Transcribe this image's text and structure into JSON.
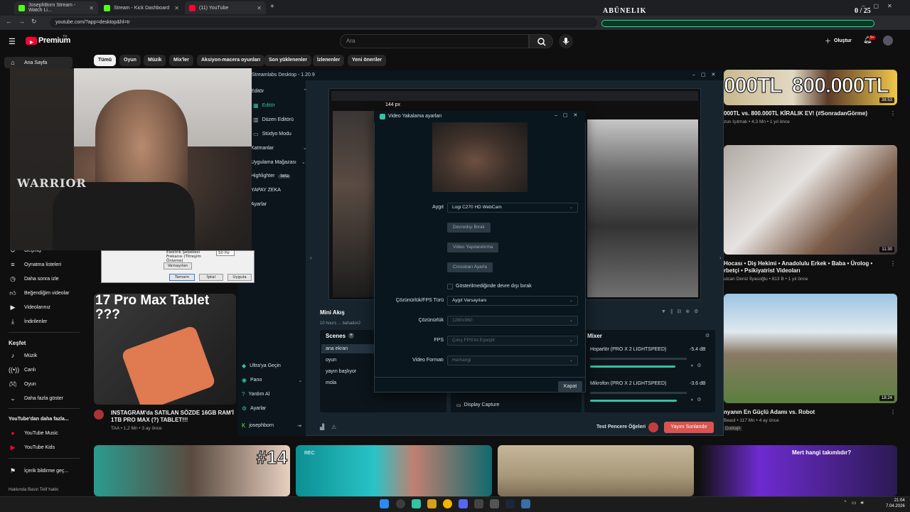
{
  "browser": {
    "tabs": [
      {
        "title": "JosephBorn Stream - Watch Li..."
      },
      {
        "title": "Stream - Kick Dashboard"
      },
      {
        "title": "(11) YouTube"
      }
    ],
    "url": "youtube.com/?app=desktop&hl=tr",
    "colors": {
      "kick": "#53fc18",
      "youtube": "#ff0033"
    }
  },
  "overlay": {
    "title": "ABÜNELIK",
    "count": "0 / 25",
    "accent": "#2de39c"
  },
  "youtube": {
    "logo": "Premium",
    "logo_sup": "TR",
    "search_placeholder": "Ara",
    "create_label": "Oluştur",
    "notif_badge": "9+",
    "chips": [
      "Tümü",
      "Oyun",
      "Müzik",
      "Mix'ler",
      "Aksiyon-macera oyunları",
      "Son yüklenenler",
      "İzlenenler",
      "Yeni öneriler"
    ],
    "sidebar": {
      "top": [
        {
          "icon": "home-icon",
          "label": "Ana Sayfa"
        }
      ],
      "you": [
        {
          "icon": "history-icon",
          "label": "Geçmiş"
        },
        {
          "icon": "playlist-icon",
          "label": "Oynatma listeleri"
        },
        {
          "icon": "clock-icon",
          "label": "Daha sonra izle"
        },
        {
          "icon": "like-icon",
          "label": "Beğendiğim videolar"
        },
        {
          "icon": "video-icon",
          "label": "Videolarınız"
        },
        {
          "icon": "download-icon",
          "label": "İndirilenler"
        }
      ],
      "explore_title": "Keşfet",
      "explore": [
        {
          "icon": "music-icon",
          "label": "Müzik"
        },
        {
          "icon": "live-icon",
          "label": "Canlı"
        },
        {
          "icon": "gaming-icon",
          "label": "Oyun"
        },
        {
          "icon": "chevron-down-icon",
          "label": "Daha fazla göster"
        }
      ],
      "more_title": "YouTube'dan daha fazla...",
      "more": [
        {
          "icon": "yt-music-icon",
          "label": "YouTube Music"
        },
        {
          "icon": "yt-kids-icon",
          "label": "YouTube Kids"
        }
      ],
      "report": "İçerik bildirme geç...",
      "footer": "Hakkında  Basın  Telif hakkı"
    },
    "videos": {
      "right1": {
        "title": "000TL vs. 800.000TL KİRALIK EV! (#SonradanGörme)",
        "meta": "zun Işıtmak  •  4,3 Mn  •  1 yıl önce",
        "thumb_text": "000TL  800.000TL",
        "duration": "38:53"
      },
      "right2": {
        "title": "Hocası • Diş Hekimi • Anadolulu Erkek • Baba • Ürolog • rbetçi • Psikiyatrist Videoları",
        "meta": "utcan Deniz İlyasoğlu  •  813 B  •  1 yıl önce",
        "duration": "11:30"
      },
      "right3": {
        "title": "nyanın En Güçlü Adamı vs. Robot",
        "meta": "Beast  •  117 Mn  •  4 ay önce",
        "meta2": "Dublajlı",
        "duration": "18:24"
      },
      "left": {
        "thumb_text": "17 Pro Max Tablet ???",
        "title": "INSTAGRAM'da SATILAN SÖZDE 16GB RAM'İ 1TB PRO MAX (?) TABLET!!!",
        "meta": "TAA  •  1,2 Mn  •  3 ay önce"
      },
      "bottom": [
        {
          "overlay": "#14"
        },
        {
          "overlay": "REC"
        },
        {
          "overlay": ""
        },
        {
          "overlay": "Mert hangi takımlıdır?"
        }
      ]
    }
  },
  "streamlabs": {
    "title": "Streamlabs Desktop - 1.20.9",
    "nav": [
      {
        "icon": "editor-icon",
        "label": "Editör",
        "section": true
      },
      {
        "icon": "editor-icon",
        "label": "Editör",
        "active": true
      },
      {
        "icon": "layout-icon",
        "label": "Düzen Editörü"
      },
      {
        "icon": "studio-icon",
        "label": "Stüdyo Modu"
      },
      {
        "icon": "themes-icon",
        "label": "Katmanlar",
        "section": true
      },
      {
        "icon": "store-icon",
        "label": "Uygulama Mağazası"
      },
      {
        "icon": "highlight-icon",
        "label": "Highlighter",
        "badge": "beta"
      },
      {
        "icon": "ai-icon",
        "label": "YAPAY ZEKA"
      },
      {
        "icon": "settings-icon",
        "label": "Ayarlar"
      }
    ],
    "nav_bottom": [
      {
        "icon": "ultra-icon",
        "label": "Ultra'ya Geçin"
      },
      {
        "icon": "dashboard-icon",
        "label": "Pano"
      },
      {
        "icon": "help-icon",
        "label": "Yardım Al"
      },
      {
        "icon": "settings-icon",
        "label": "Ayarlar"
      },
      {
        "icon": "kick-icon",
        "label": "josephborn"
      }
    ],
    "preview_scale": "144  px",
    "mini_feed": {
      "title": "Mini Akış",
      "entry": "10 hours ... bahador2"
    },
    "scenes": {
      "title": "Scenes",
      "items": [
        "ana ekran",
        "oyun",
        "yayın başlıyor",
        "mola"
      ]
    },
    "sources": {
      "item": "Display Capture"
    },
    "mixer": {
      "title": "Mixer",
      "channels": [
        {
          "name": "Hoparlör (PRO X 2 LIGHTSPEED)",
          "db": "-5.4 dB",
          "level": 0.88
        },
        {
          "name": "Mikrofon (PRO X 2 LIGHTSPEED)",
          "db": "-3.6 dB",
          "level": 0.9
        }
      ]
    },
    "footer": {
      "test_label": "Test Pencere Öğeleri",
      "end_stream": "Yayını Sonlandır"
    },
    "accent": "#31c3a2"
  },
  "dialog": {
    "title": "Video Yakalama ayarları",
    "device_label": "Aygıt",
    "device_value": "Logi C270 HD WebCam",
    "btn_disable": "Devredışı Bırak",
    "btn_config_video": "Video Yapılandırma",
    "btn_crossbar": "Crossbarı Ayarla",
    "checkbox_label": "Gösterilmediğinde devre dışı bırak",
    "res_type_label": "Çözünürlük/FPS Türü",
    "res_type_value": "Aygıt Varsayılanı",
    "res_label": "Çözünürlük",
    "res_value": "1280x960",
    "fps_label": "FPS",
    "fps_value": "Çıkış FPS'ini Eşleştir",
    "format_label": "Video Formatı",
    "format_value": "Herhangi",
    "close_label": "Kapat"
  },
  "old_dialog": {
    "row_label": "Elektrik Şebekesi Frekansı (Titreşim Önleme)",
    "row_value": "50 Hz",
    "defaults": "Varsayılan",
    "ok": "Tamam",
    "cancel": "İptal",
    "apply": "Uygula"
  },
  "webcam": {
    "shirt_text": "WARRIOR"
  },
  "taskbar": {
    "time": "21:04",
    "date": "7.04.2026"
  }
}
